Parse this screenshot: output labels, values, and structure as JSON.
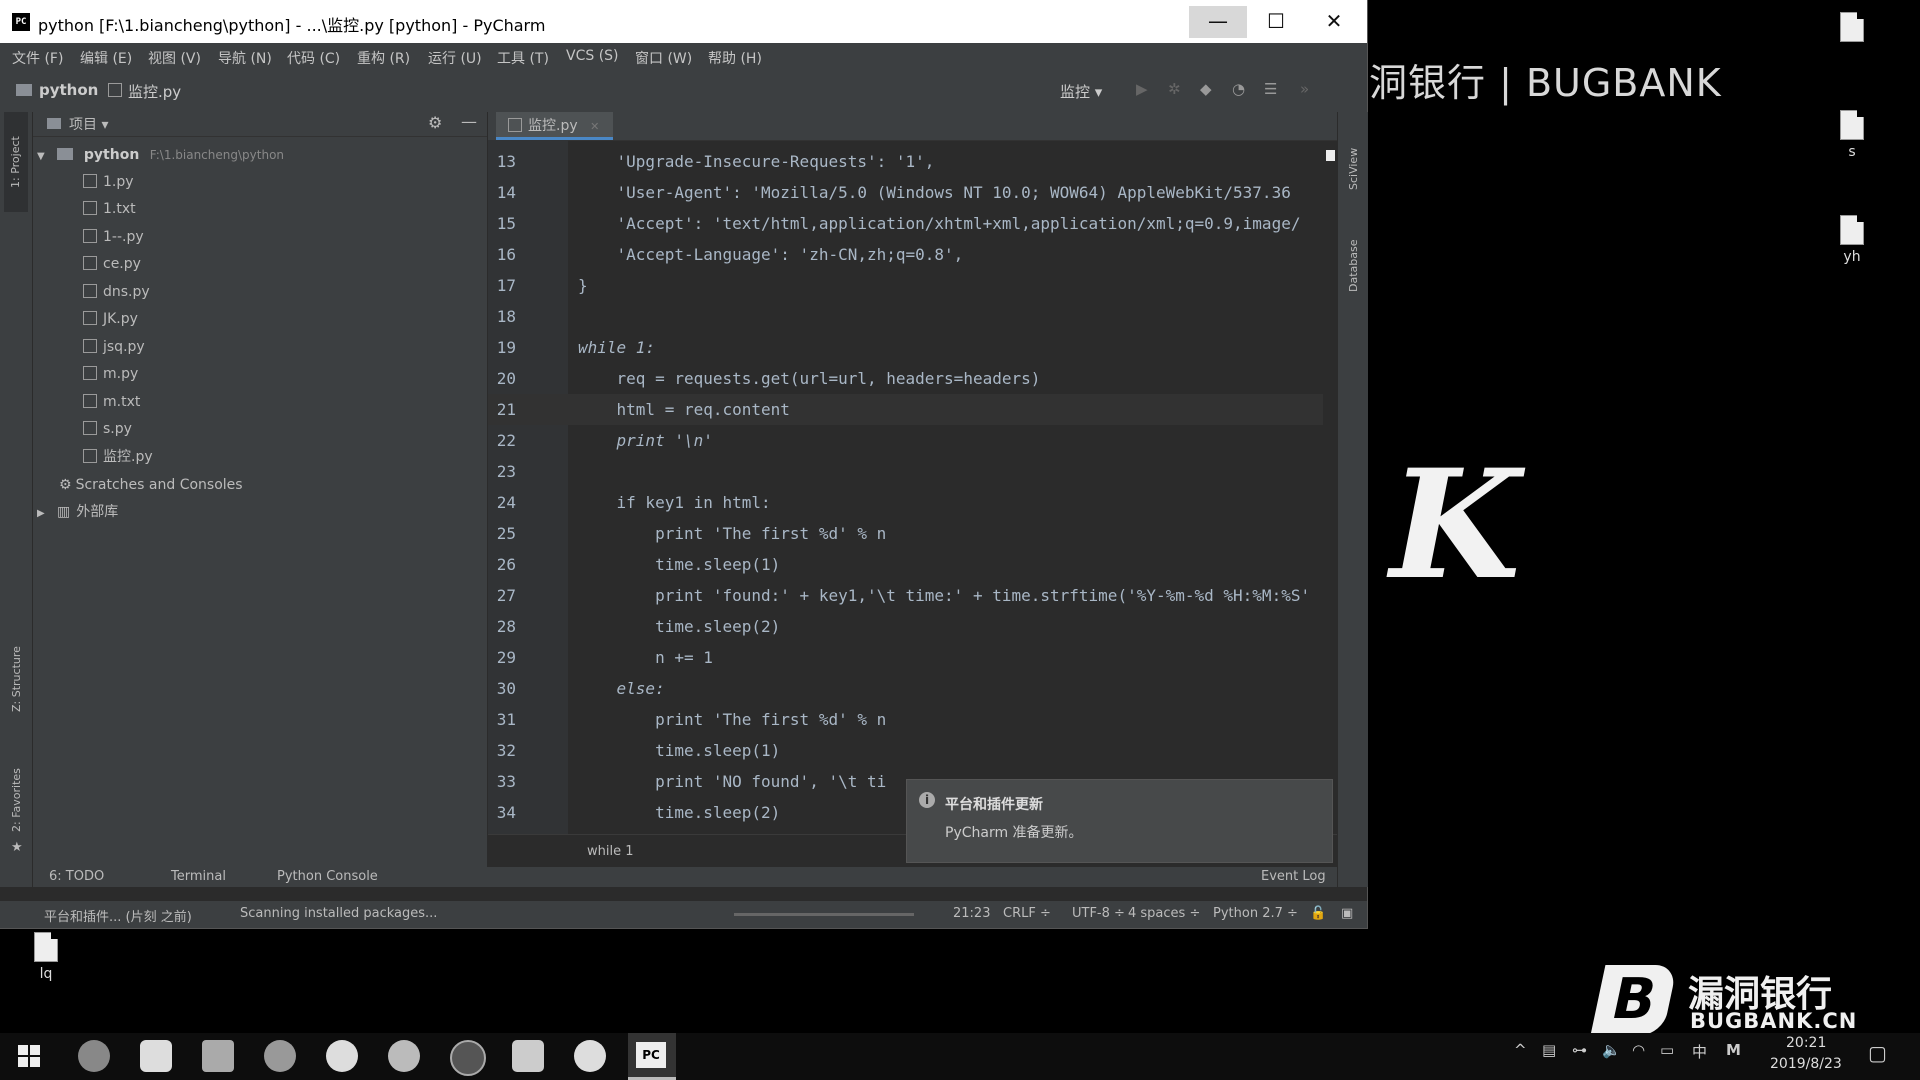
{
  "window": {
    "title": "python [F:\\1.biancheng\\python] - ...\\监控.py [python] - PyCharm",
    "minimize_glyph": "—",
    "maximize_glyph": "☐",
    "close_glyph": "✕"
  },
  "menubar": [
    "文件 (F)",
    "编辑 (E)",
    "视图 (V)",
    "导航 (N)",
    "代码 (C)",
    "重构 (R)",
    "运行 (U)",
    "工具 (T)",
    "VCS (S)",
    "窗口 (W)",
    "帮助 (H)"
  ],
  "navbar": {
    "project": "python",
    "file": "监控.py",
    "run_config": "监控"
  },
  "side_tabs": {
    "project": "1: Project",
    "structure": "Z: Structure",
    "favorites": "2: Favorites",
    "sciview": "SciView",
    "database": "Database"
  },
  "project_panel": {
    "header": "项目",
    "root_name": "python",
    "root_path": "F:\\1.biancheng\\python",
    "files": [
      "1.py",
      "1.txt",
      "1--.py",
      "ce.py",
      "dns.py",
      "JK.py",
      "jsq.py",
      "m.py",
      "m.txt",
      "s.py",
      "监控.py"
    ],
    "scratches": "Scratches and Consoles",
    "external_libs": "外部库"
  },
  "editor": {
    "tab": "监控.py",
    "breadcrumb": "while 1",
    "lines": [
      {
        "n": "13",
        "text": "    'Upgrade-Insecure-Requests': '1',"
      },
      {
        "n": "14",
        "text": "    'User-Agent': 'Mozilla/5.0 (Windows NT 10.0; WOW64) AppleWebKit/537.36"
      },
      {
        "n": "15",
        "text": "    'Accept': 'text/html,application/xhtml+xml,application/xml;q=0.9,image/"
      },
      {
        "n": "16",
        "text": "    'Accept-Language': 'zh-CN,zh;q=0.8',"
      },
      {
        "n": "17",
        "text": "}"
      },
      {
        "n": "18",
        "text": ""
      },
      {
        "n": "19",
        "text": "while 1:"
      },
      {
        "n": "20",
        "text": "    req = requests.get(url=url, headers=headers)"
      },
      {
        "n": "21",
        "text": "    html = req.content"
      },
      {
        "n": "22",
        "text": "    print '\\n'"
      },
      {
        "n": "23",
        "text": ""
      },
      {
        "n": "24",
        "text": "    if key1 in html:"
      },
      {
        "n": "25",
        "text": "        print 'The first %d' % n"
      },
      {
        "n": "26",
        "text": "        time.sleep(1)"
      },
      {
        "n": "27",
        "text": "        print 'found:' + key1,'\\t time:' + time.strftime('%Y-%m-%d %H:%M:%S'"
      },
      {
        "n": "28",
        "text": "        time.sleep(2)"
      },
      {
        "n": "29",
        "text": "        n += 1"
      },
      {
        "n": "30",
        "text": "    else:"
      },
      {
        "n": "31",
        "text": "        print 'The first %d' % n"
      },
      {
        "n": "32",
        "text": "        time.sleep(1)"
      },
      {
        "n": "33",
        "text": "        print 'NO found', '\\t ti"
      },
      {
        "n": "34",
        "text": "        time.sleep(2)"
      }
    ],
    "current_line": "21"
  },
  "notification": {
    "title": "平台和插件更新",
    "body": "PyCharm 准备更新。"
  },
  "tool_tabs": {
    "todo": "6: TODO",
    "terminal": "Terminal",
    "python_console": "Python Console",
    "event_log": "Event Log"
  },
  "statusbar": {
    "message": "平台和插件... (片刻 之前)",
    "task": "Scanning installed packages...",
    "position": "21:23",
    "line_sep": "CRLF ÷",
    "encoding": "UTF-8 ÷",
    "indent": "4 spaces ÷",
    "interpreter": "Python 2.7 ÷"
  },
  "desktop": {
    "icons": [
      "s",
      "yh",
      "lq"
    ],
    "watermark_text": "漏洞银行 | BUGBANK",
    "logo_cn": "漏洞银行",
    "logo_en": "BUGBANK.CN",
    "big_letter": "K"
  },
  "taskbar": {
    "time": "20:21",
    "date": "2019/8/23",
    "ime": "中",
    "ime2": "M"
  }
}
